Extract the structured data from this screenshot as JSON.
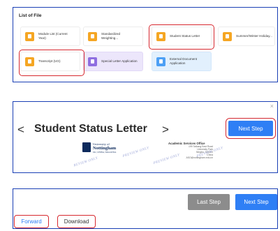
{
  "file_list": {
    "title": "List of File",
    "cards": [
      {
        "label": "Module List (Current Year)",
        "icon": "document-icon",
        "color": "#f5a623"
      },
      {
        "label": "Standardized Weighting...",
        "icon": "document-icon",
        "color": "#f5a623"
      },
      {
        "label": "Student Status Letter",
        "icon": "document-icon",
        "color": "#f5a623"
      },
      {
        "label": "Summer/Winter Holiday...",
        "icon": "document-icon",
        "color": "#f5a623"
      },
      {
        "label": "Transcript (UG)",
        "icon": "transcript-icon",
        "color": "#f5a623"
      },
      {
        "label": "Special Letter Application",
        "icon": "letter-icon",
        "color": "#8f6fe0"
      },
      {
        "label": "External Document Application",
        "icon": "document-icon",
        "color": "#4da0f5"
      }
    ]
  },
  "preview": {
    "close": "×",
    "prev_arrow": "<",
    "title": "Student Status Letter",
    "next_arrow": ">",
    "next_step": "Next Step",
    "logo_line1": "University of",
    "logo_line2": "Nottingham",
    "logo_line3": "UK | CHINA | MALAYSIA",
    "office_title": "Academic Services Office",
    "office_lines": [
      "199 Taikang East Road",
      "University Park",
      "Ningbo, 315100",
      "China",
      "ASO@nottingham.edu.cn"
    ],
    "watermarks": [
      "REVIEW ONLY",
      "PREVIEW ONLY",
      "PREVIEW ONLY",
      "PREVIEW ONLY"
    ]
  },
  "actions": {
    "last_step": "Last Step",
    "next_step": "Next Step",
    "forward": "Forward",
    "download": "Download"
  },
  "colors": {
    "highlight": "#d7282f",
    "primary": "#2f7ff5",
    "panel_border": "#1a3fb5"
  }
}
